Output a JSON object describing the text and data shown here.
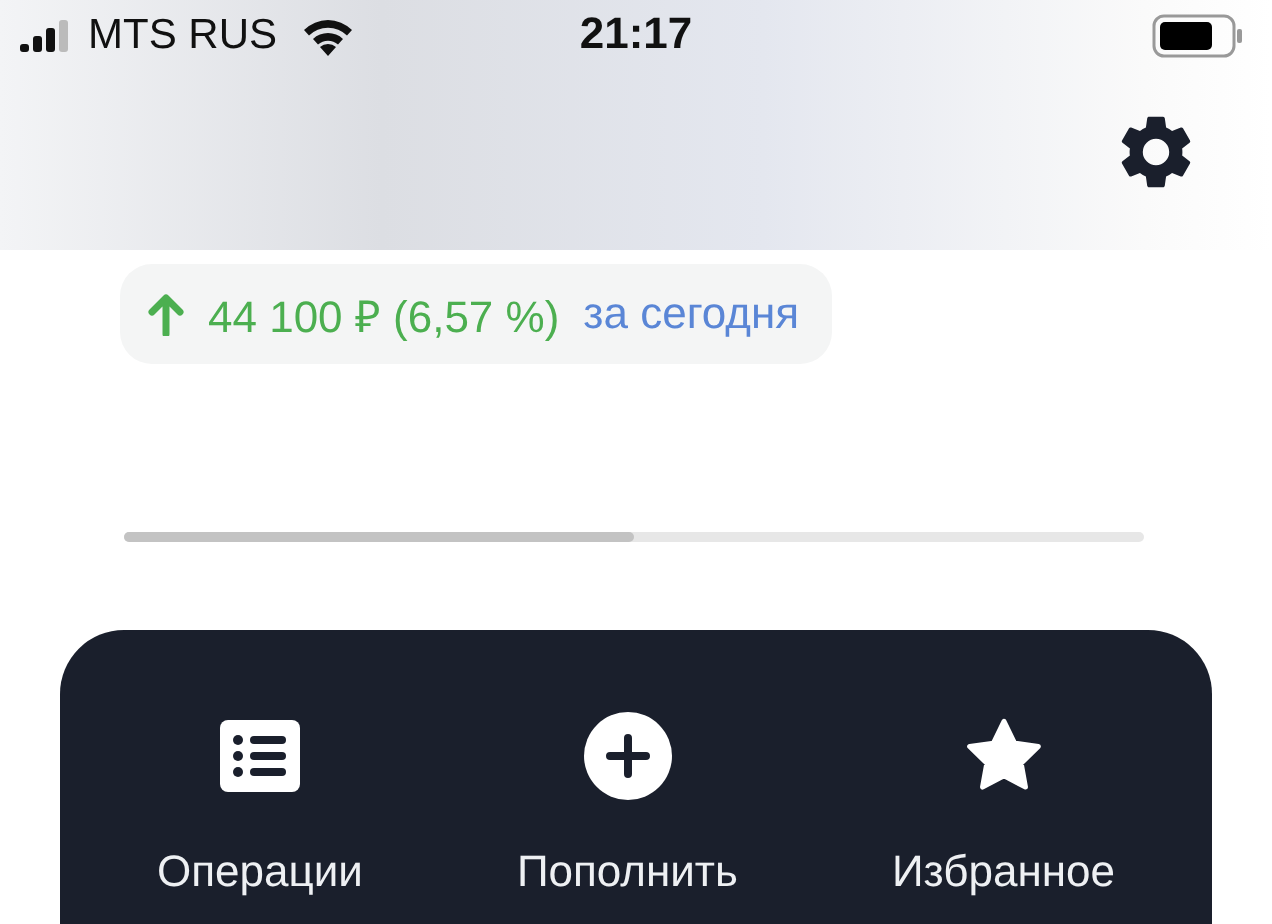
{
  "status_bar": {
    "carrier": "MTS RUS",
    "time": "21:17"
  },
  "change": {
    "kind": "up",
    "amount": "44 100 ₽ (6,57 %)",
    "period": "за сегодня"
  },
  "progress": {
    "level": 0.5
  },
  "actions": [
    {
      "kind": "list",
      "label": "Операции"
    },
    {
      "kind": "add",
      "label": "Пополнить"
    },
    {
      "kind": "star",
      "label": "Избранное"
    }
  ]
}
